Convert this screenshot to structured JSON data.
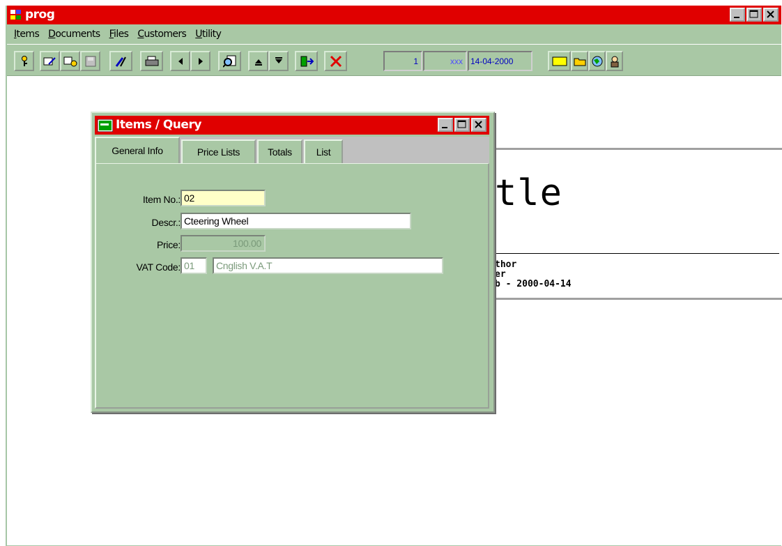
{
  "app": {
    "title": "prog"
  },
  "menu": [
    {
      "pre": "",
      "u": "I",
      "post": "tems"
    },
    {
      "pre": "",
      "u": "D",
      "post": "ocuments"
    },
    {
      "pre": "",
      "u": "F",
      "post": "iles"
    },
    {
      "pre": "",
      "u": "C",
      "post": "ustomers"
    },
    {
      "pre": "",
      "u": "U",
      "post": "tility"
    }
  ],
  "toolbar": {
    "record_number": "1",
    "user": "xxx",
    "date": "14-04-2000"
  },
  "colors": {
    "titlebar": "#e00000",
    "form_background": "#a9c8a5",
    "date_text": "#0000c0"
  },
  "document": {
    "title_fragment": "tle",
    "lines": [
      "thor",
      "er",
      "b - 2000-04-14"
    ]
  },
  "dialog": {
    "title": "Items / Query",
    "tabs": [
      "General Info",
      "Price Lists",
      "Totals",
      "List"
    ],
    "active_tab": "General Info",
    "fields": {
      "item_no": {
        "label": "Item No.:",
        "value": "02"
      },
      "descr": {
        "label": "Descr.:",
        "value": "Cteering Wheel"
      },
      "price": {
        "label": "Price:",
        "value": "100.00"
      },
      "vat": {
        "label": "VAT Code:",
        "code": "01",
        "description": "Cnglish V.A.T"
      }
    }
  }
}
